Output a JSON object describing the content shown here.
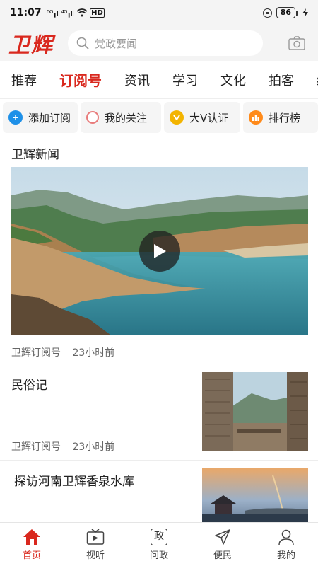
{
  "status_bar": {
    "time": "11:07",
    "signal": "⁵ᴳ╻ıl ⁴ᴳ╻ıl",
    "hd": "HD",
    "battery": "86"
  },
  "header": {
    "logo": "卫辉",
    "search_placeholder": "党政要闻"
  },
  "tabs": [
    "推荐",
    "订阅号",
    "资讯",
    "学习",
    "文化",
    "拍客",
    "经"
  ],
  "active_tab": "订阅号",
  "quick_actions": [
    {
      "label": "添加订阅",
      "icon": "plus-icon",
      "color": "#1e90e8"
    },
    {
      "label": "我的关注",
      "icon": "circle-icon",
      "color": "#e87a7a"
    },
    {
      "label": "大V认证",
      "icon": "verified-icon",
      "color": "#f3b400"
    },
    {
      "label": "排行榜",
      "icon": "bar-chart-icon",
      "color": "#ff8a1a"
    }
  ],
  "section_title": "卫辉新闻",
  "featured": {
    "source": "卫辉订阅号",
    "time": "23小时前"
  },
  "articles": [
    {
      "title": "民俗记",
      "source": "卫辉订阅号",
      "time": "23小时前"
    },
    {
      "title": "探访河南卫辉香泉水库"
    }
  ],
  "bottom_nav": [
    {
      "label": "首页",
      "icon": "home-icon"
    },
    {
      "label": "视听",
      "icon": "tv-icon"
    },
    {
      "label": "问政",
      "icon": "zheng-icon",
      "glyph": "政"
    },
    {
      "label": "便民",
      "icon": "send-icon"
    },
    {
      "label": "我的",
      "icon": "user-icon"
    }
  ],
  "colors": {
    "brand_red": "#d9281e",
    "header_bg": "#f4f4f4"
  }
}
